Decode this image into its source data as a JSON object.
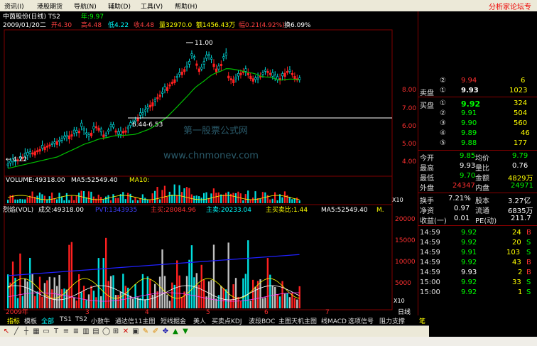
{
  "menu": {
    "items": [
      "资讯(I)",
      "港股期货",
      "导航(N)",
      "辅助(D)",
      "工具(V)",
      "帮助(H)"
    ],
    "brand": "分析家论坛专"
  },
  "header": {
    "title": "中茵股份(日线) TS2",
    "year_label": "年:9.97",
    "date": "2009/01/20二",
    "open_label": "开4.30",
    "high_label": "高4.48",
    "low_label": "低4.22",
    "close_label": "收4.48",
    "volume_label": "量32970.0",
    "amount_label": "额1456.43万",
    "change_label": "幅0.21(4.92%)",
    "turnover_label": "换6.09%",
    "extra": "换6"
  },
  "main_chart": {
    "high_annotation": "11.00",
    "low_annotation": "4.22",
    "range_annotation": "6.44-6.53",
    "watermark_cn": "第一股票公式网",
    "watermark_url": "www.chnmonev.com",
    "price_ticks": [
      "8.00",
      "7.00",
      "6.00",
      "5.00",
      "4.00"
    ]
  },
  "volume_panel": {
    "label": "VOLUME:49318.00",
    "ma5": "MA5:52549.40",
    "ma10": "MA10:",
    "x10": "X10"
  },
  "indicator_panel": {
    "title": "烈焰(VOL)",
    "vol": "成交:49318.00",
    "pvt": "PVT:1343935",
    "main_buy": "主买:28084.96",
    "main_sell": "主卖:20233.04",
    "ratio": "主买卖比:1.44",
    "ma5": "MA5:52549.40",
    "ma_tail": "M.",
    "ticks": [
      "20000",
      "15000",
      "10000",
      "5000"
    ],
    "x10": "X10"
  },
  "x_axis": {
    "year": "2009年",
    "months": [
      "3",
      "4",
      "5",
      "6",
      "7"
    ],
    "period": "日线"
  },
  "sidebar": {
    "sell_label": "卖盘",
    "buy_label": "买盘",
    "top_rows": [
      {
        "idx": "②",
        "price": "9.94",
        "vol": "6"
      },
      {
        "idx": "①",
        "price": "9.93",
        "vol": "1023"
      }
    ],
    "buy_rows": [
      {
        "idx": "①",
        "price": "9.92",
        "vol": "324"
      },
      {
        "idx": "②",
        "price": "9.91",
        "vol": "504"
      },
      {
        "idx": "③",
        "price": "9.90",
        "vol": "560"
      },
      {
        "idx": "④",
        "price": "9.89",
        "vol": "46"
      },
      {
        "idx": "⑤",
        "price": "9.88",
        "vol": "177"
      }
    ],
    "stats": [
      {
        "k1": "今开",
        "v1": "9.85",
        "k2": "均价",
        "v2": "9.79"
      },
      {
        "k1": "最高",
        "v1": "9.93",
        "k2": "量比",
        "v2": "0.76"
      },
      {
        "k1": "最低",
        "v1": "9.70",
        "k2": "金额",
        "v2": "4829万"
      },
      {
        "k1": "外盘",
        "v1": "24347",
        "k2": "内盘",
        "v2": "24971"
      }
    ],
    "stats2": [
      {
        "k1": "换手",
        "v1": "7.21%",
        "k2": "股本",
        "v2": "3.27亿"
      },
      {
        "k1": "净资",
        "v1": "0.97",
        "k2": "流通",
        "v2": "6835万"
      },
      {
        "k1": "收益(一)",
        "v1": "0.01",
        "k2": "PE(动)",
        "v2": "211.7"
      }
    ],
    "ticks": [
      {
        "time": "14:59",
        "price": "9.92",
        "vol": "24",
        "dir": "B"
      },
      {
        "time": "14:59",
        "price": "9.92",
        "vol": "20",
        "dir": "S"
      },
      {
        "time": "14:59",
        "price": "9.91",
        "vol": "103",
        "dir": "S"
      },
      {
        "time": "14:59",
        "price": "9.92",
        "vol": "43",
        "dir": "B"
      },
      {
        "time": "14:59",
        "price": "9.93",
        "vol": "2",
        "dir": "B"
      },
      {
        "time": "15:00",
        "price": "9.92",
        "vol": "33",
        "dir": "S"
      },
      {
        "time": "15:00",
        "price": "9.92",
        "vol": "1",
        "dir": "S"
      }
    ]
  },
  "tabs": [
    "指标",
    "模板",
    "全部",
    "TS1",
    "TS2",
    "小敖牛",
    "通达信11主图",
    "短线掘金",
    "美人",
    "买卖点KDJ",
    "波段BOC",
    "主图天机主图",
    "线MACD",
    "选项信号",
    "阻力支撑",
    "笔"
  ],
  "footer_watermark": "www.7gpzb.com",
  "colors": {
    "up": "#ff2020",
    "down": "#00e0e0",
    "ma": "#00c000",
    "accent_yellow": "#ffff00",
    "panel_border": "#800000"
  }
}
